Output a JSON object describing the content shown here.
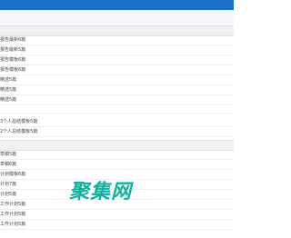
{
  "section_one": {
    "items": [
      {
        "label": "报告最新6篇"
      },
      {
        "label": "报告最新5篇"
      },
      {
        "label": "报告模板6篇"
      },
      {
        "label": "报告模板6篇"
      },
      {
        "label": "精选5篇"
      },
      {
        "label": "精选5篇"
      },
      {
        "label": "精选5篇"
      },
      {
        "label": "3个人总结模板5篇"
      },
      {
        "label": "2个人总结模板5篇"
      }
    ]
  },
  "section_two": {
    "items": [
      {
        "label": "草稿5篇"
      },
      {
        "label": "草稿6篇"
      },
      {
        "label": "计划模板6篇"
      },
      {
        "label": "计划7篇"
      },
      {
        "label": "计划5篇"
      },
      {
        "label": "工作计划5篇"
      },
      {
        "label": "工作计划5篇"
      },
      {
        "label": "工作计划5篇"
      }
    ]
  },
  "watermark": {
    "text": "聚集网"
  }
}
